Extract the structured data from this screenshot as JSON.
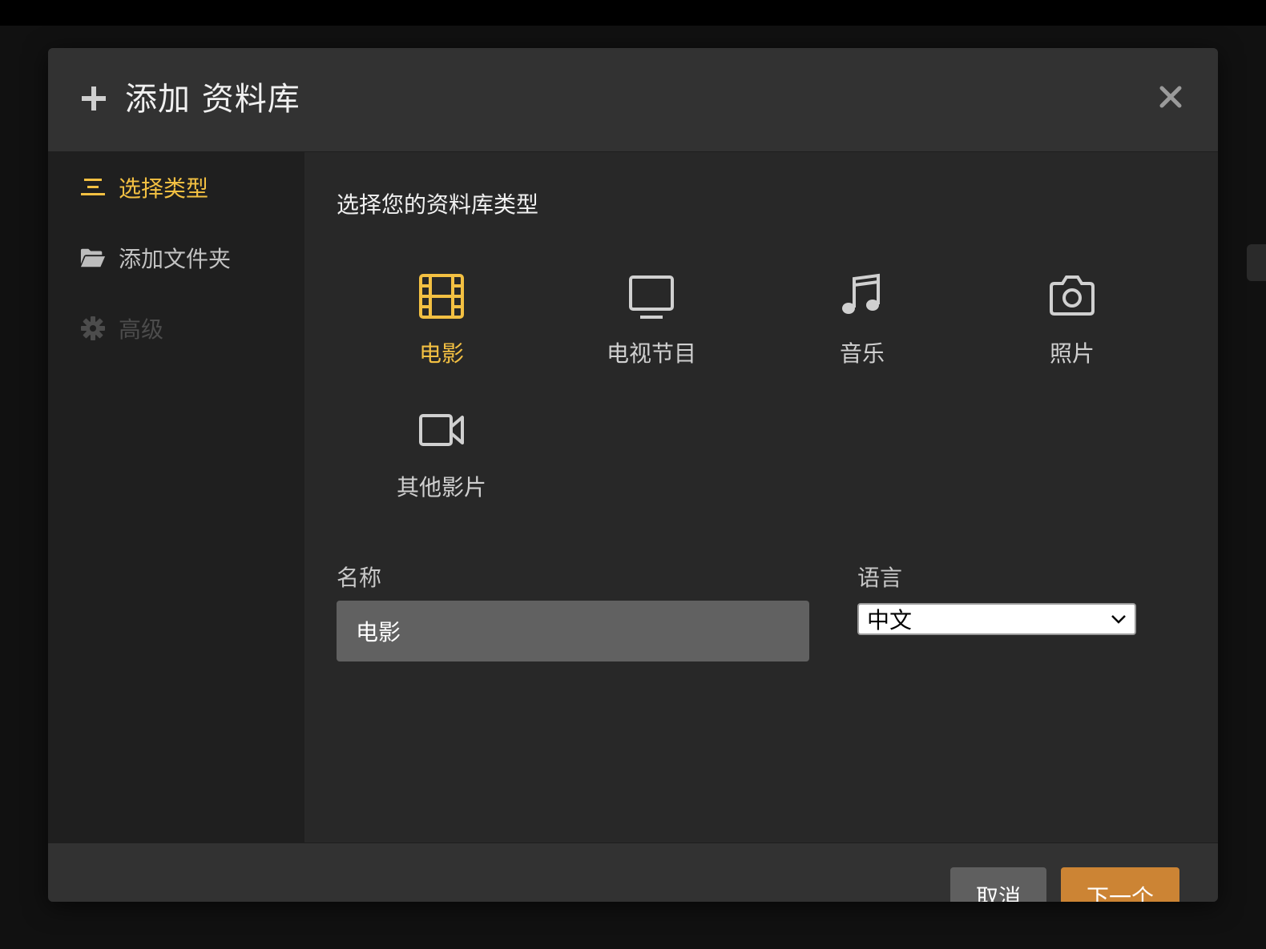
{
  "dialog": {
    "title": "添加 资料库"
  },
  "sidebar": {
    "items": [
      {
        "label": "选择类型",
        "state": "active",
        "icon": "list-icon"
      },
      {
        "label": "添加文件夹",
        "state": "normal",
        "icon": "folder-open-icon"
      },
      {
        "label": "高级",
        "state": "disabled",
        "icon": "gear-icon"
      }
    ]
  },
  "content": {
    "title": "选择您的资料库类型",
    "types": [
      {
        "label": "电影",
        "icon": "film-icon",
        "selected": true
      },
      {
        "label": "电视节目",
        "icon": "tv-icon",
        "selected": false
      },
      {
        "label": "音乐",
        "icon": "music-note-icon",
        "selected": false
      },
      {
        "label": "照片",
        "icon": "camera-icon",
        "selected": false
      },
      {
        "label": "其他影片",
        "icon": "video-camera-icon",
        "selected": false
      }
    ],
    "name_label": "名称",
    "name_value": "电影",
    "language_label": "语言",
    "language_value": "中文"
  },
  "footer": {
    "cancel_label": "取消",
    "next_label": "下一个"
  },
  "colors": {
    "accent": "#f3c042",
    "primary_button": "#cc8434",
    "secondary_button": "#5f5f5f"
  }
}
